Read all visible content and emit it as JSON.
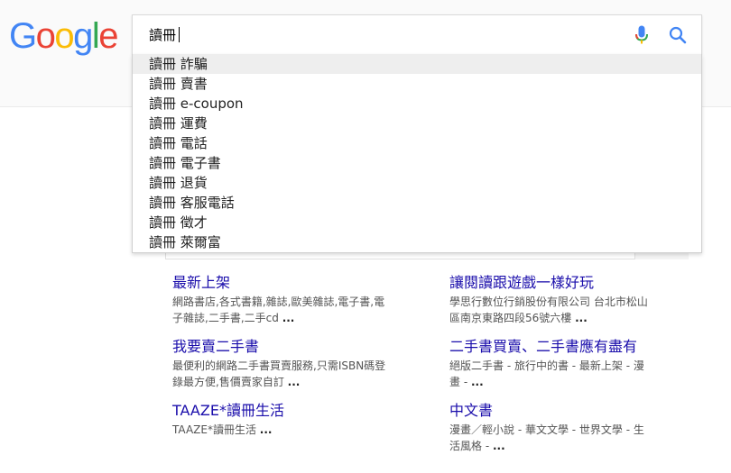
{
  "logo": {
    "text": "Google",
    "letter_colors": [
      "#4285F4",
      "#EA4335",
      "#FBBC05",
      "#4285F4",
      "#34A853",
      "#EA4335"
    ]
  },
  "search": {
    "query": "讀冊",
    "mic_icon": "microphone-icon",
    "search_icon": "magnifier-icon"
  },
  "suggestions": [
    "讀冊 詐騙",
    "讀冊 賣書",
    "讀冊 e-coupon",
    "讀冊 運費",
    "讀冊 電話",
    "讀冊 電子書",
    "讀冊 退貨",
    "讀冊 客服電話",
    "讀冊 徵才",
    "讀冊 萊爾富"
  ],
  "results": {
    "left": [
      {
        "title": "最新上架",
        "snippet": "網路書店,各式書籍,雜誌,歐美雜誌,電子書,電子雜誌,二手書,二手cd",
        "more": "..."
      },
      {
        "title": "我要賣二手書",
        "snippet": "最便利的網路二手書買賣服務,只需ISBN碼登錄最方便,售價賣家自訂",
        "more": "..."
      },
      {
        "title": "TAAZE*讀冊生活",
        "snippet": "TAAZE*讀冊生活",
        "more": "..."
      }
    ],
    "right": [
      {
        "title": "讓閱讀跟遊戲一樣好玩",
        "snippet": "學思行數位行銷股份有限公司 台北市松山區南京東路四段56號六樓",
        "more": "..."
      },
      {
        "title": "二手書買賣、二手書應有盡有",
        "snippet": "絕版二手書 - 旅行中的書 - 最新上架 - 漫畫 -",
        "more": "..."
      },
      {
        "title": "中文書",
        "snippet": "漫畫／輕小說 - 華文文學 - 世界文學 - 生活風格 -",
        "more": "..."
      }
    ]
  },
  "colors": {
    "link": "#1a0dab",
    "snippet": "#545454",
    "highlight": "#eeeeee"
  }
}
